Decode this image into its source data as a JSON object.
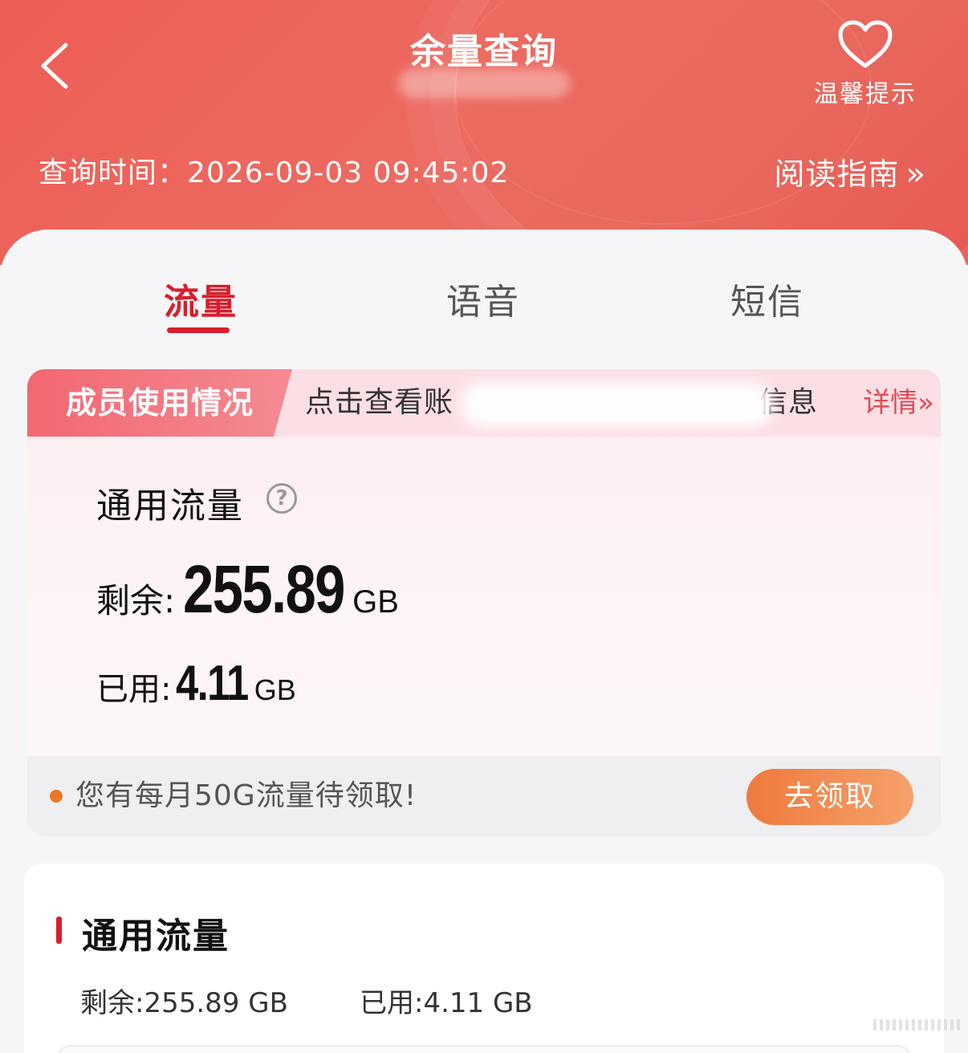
{
  "header": {
    "title": "余量查询",
    "tips_label": "温馨提示",
    "query_time": "查询时间：2026-09-03 09:45:02",
    "guide_label": "阅读指南",
    "guide_chevron": "»"
  },
  "tabs": [
    {
      "label": "流量",
      "active": true
    },
    {
      "label": "语音",
      "active": false
    },
    {
      "label": "短信",
      "active": false
    }
  ],
  "member": {
    "tag": "成员使用情况",
    "text": "点击查看账",
    "text_tail": "信息",
    "detail": "详情»"
  },
  "usage": {
    "title": "通用流量",
    "help": "?",
    "remain_label": "剩余:",
    "remain_value": "255.89",
    "remain_unit": "GB",
    "used_label": "已用:",
    "used_value": "4.11",
    "used_unit": "GB"
  },
  "promo": {
    "text": "您有每月50G流量待领取!",
    "button": "去领取"
  },
  "detail": {
    "title": "通用流量",
    "remain": "剩余:255.89 GB",
    "used": "已用:4.11 GB"
  },
  "colors": {
    "header_red": "#ec6a60",
    "active_red": "#d81e2b",
    "promo_orange": "#ee7a3e"
  },
  "icons": [
    "back-arrow-icon",
    "heart-icon",
    "double-chevron-right-icon",
    "help-circle-icon",
    "dot-icon"
  ]
}
